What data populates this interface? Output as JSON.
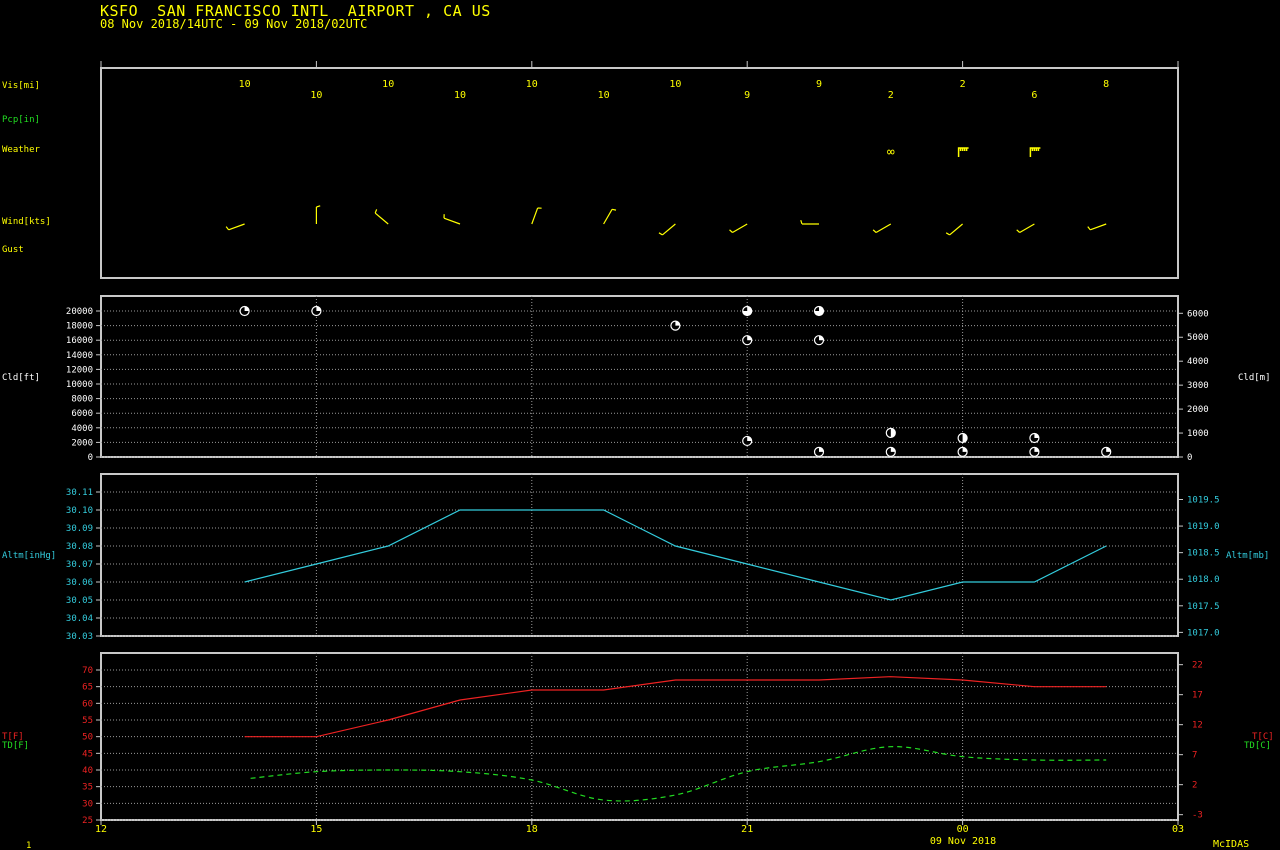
{
  "header": {
    "title": "KSFO  SAN FRANCISCO INTL  AIRPORT , CA US",
    "range": "08 Nov 2018/14UTC - 09 Nov 2018/02UTC"
  },
  "footer": {
    "page_number": "1",
    "brand": "McIDAS",
    "date_label": "09 Nov 2018"
  },
  "colors": {
    "yellow": "#ffff00",
    "green": "#22dd22",
    "cyan": "#33ccdd",
    "red": "#ee2222",
    "frame": "#c8c8c8",
    "grid": "#9a9a9a",
    "white": "#ffffff"
  },
  "chart_data": [
    {
      "type": "table",
      "panel": "obs",
      "row_labels": [
        "Vis[mi]",
        "Pcp[in]",
        "Weather",
        "Wind[kts]",
        "Gust"
      ],
      "hours": [
        14,
        15,
        16,
        17,
        18,
        19,
        20,
        21,
        22,
        23,
        24,
        25,
        26
      ],
      "visibility": [
        "10",
        "10",
        "10",
        "10",
        "10",
        "10",
        "10",
        "9",
        "9",
        "2",
        "2",
        "6",
        "8"
      ],
      "weather": [
        {
          "hour": 23,
          "symbol": "∞",
          "meaning": "haze"
        },
        {
          "hour": 24,
          "symbol": "mist"
        },
        {
          "hour": 25,
          "symbol": "mist"
        }
      ],
      "wind": [
        {
          "hour": 14,
          "dir": 250,
          "speed": 5
        },
        {
          "hour": 15,
          "dir": 360,
          "speed": 8
        },
        {
          "hour": 16,
          "dir": 310,
          "speed": 5
        },
        {
          "hour": 17,
          "dir": 290,
          "speed": 5
        },
        {
          "hour": 18,
          "dir": 20,
          "speed": 5
        },
        {
          "hour": 19,
          "dir": 30,
          "speed": 6
        },
        {
          "hour": 20,
          "dir": 230,
          "speed": 5
        },
        {
          "hour": 21,
          "dir": 240,
          "speed": 5
        },
        {
          "hour": 22,
          "dir": 270,
          "speed": 5
        },
        {
          "hour": 23,
          "dir": 240,
          "speed": 6
        },
        {
          "hour": 24,
          "dir": 230,
          "speed": 5
        },
        {
          "hour": 25,
          "dir": 240,
          "speed": 6
        },
        {
          "hour": 26,
          "dir": 250,
          "speed": 5
        }
      ]
    },
    {
      "type": "scatter",
      "panel": "cloud",
      "ylabel_left": "Cld[ft]",
      "ylabel_right": "Cld[m]",
      "ylim_ft": [
        0,
        22000
      ],
      "yticks_ft": [
        0,
        2000,
        4000,
        6000,
        8000,
        10000,
        12000,
        14000,
        16000,
        18000,
        20000
      ],
      "yticks_m": [
        0,
        1000,
        2000,
        3000,
        4000,
        5000,
        6000
      ],
      "layers": [
        {
          "hour": 14,
          "ft": 20000,
          "cover": "few"
        },
        {
          "hour": 15,
          "ft": 20000,
          "cover": "few"
        },
        {
          "hour": 20,
          "ft": 18000,
          "cover": "few"
        },
        {
          "hour": 21,
          "ft": 20000,
          "cover": "broken"
        },
        {
          "hour": 21,
          "ft": 16000,
          "cover": "few"
        },
        {
          "hour": 21,
          "ft": 2200,
          "cover": "few"
        },
        {
          "hour": 22,
          "ft": 20000,
          "cover": "broken"
        },
        {
          "hour": 22,
          "ft": 16000,
          "cover": "few"
        },
        {
          "hour": 22,
          "ft": 700,
          "cover": "few"
        },
        {
          "hour": 23,
          "ft": 3300,
          "cover": "scattered"
        },
        {
          "hour": 23,
          "ft": 700,
          "cover": "few"
        },
        {
          "hour": 24,
          "ft": 2600,
          "cover": "scattered"
        },
        {
          "hour": 24,
          "ft": 700,
          "cover": "few"
        },
        {
          "hour": 25,
          "ft": 2600,
          "cover": "few"
        },
        {
          "hour": 25,
          "ft": 700,
          "cover": "few"
        },
        {
          "hour": 26,
          "ft": 700,
          "cover": "few"
        }
      ]
    },
    {
      "type": "line",
      "panel": "altimeter",
      "ylabel_left": "Altm[inHg]",
      "ylabel_right": "Altm[mb]",
      "ylim": [
        30.03,
        30.115
      ],
      "yticks": [
        "30.03",
        "30.04",
        "30.05",
        "30.06",
        "30.07",
        "30.08",
        "30.09",
        "30.10",
        "30.11"
      ],
      "yticks_mb": [
        "1017.0",
        "1017.5",
        "1018.0",
        "1018.5",
        "1019.0",
        "1019.5"
      ],
      "x": [
        14,
        15,
        16,
        17,
        18,
        19,
        20,
        21,
        22,
        23,
        24,
        25,
        26
      ],
      "values": [
        30.06,
        30.07,
        30.08,
        30.1,
        30.1,
        30.1,
        30.08,
        30.07,
        30.06,
        30.05,
        30.06,
        30.06,
        30.08
      ]
    },
    {
      "type": "line",
      "panel": "temperature",
      "ylabel_left_t": "T[F]",
      "ylabel_left_td": "TD[F]",
      "ylabel_right_t": "T[C]",
      "ylabel_right_td": "TD[C]",
      "ylim_f": [
        25,
        72
      ],
      "yticks_f": [
        "25",
        "30",
        "35",
        "40",
        "45",
        "50",
        "55",
        "60",
        "65",
        "70"
      ],
      "yticks_c": [
        "-3",
        "2",
        "7",
        "12",
        "17",
        "22"
      ],
      "x": [
        14,
        15,
        16,
        17,
        18,
        19,
        20,
        21,
        22,
        23,
        24,
        25,
        26
      ],
      "series": [
        {
          "name": "T[F]",
          "values": [
            50,
            50,
            55,
            61,
            64,
            64,
            67,
            67,
            67,
            68,
            67,
            65,
            65
          ]
        },
        {
          "name": "TD[F]",
          "values": [
            37.5,
            39.5,
            40,
            39.5,
            37,
            31,
            32.5,
            39.5,
            42.5,
            47,
            44,
            43,
            43
          ]
        }
      ],
      "xticks": [
        "12",
        "15",
        "18",
        "21",
        "00",
        "03"
      ],
      "xrange_hours": [
        12,
        27
      ]
    }
  ]
}
